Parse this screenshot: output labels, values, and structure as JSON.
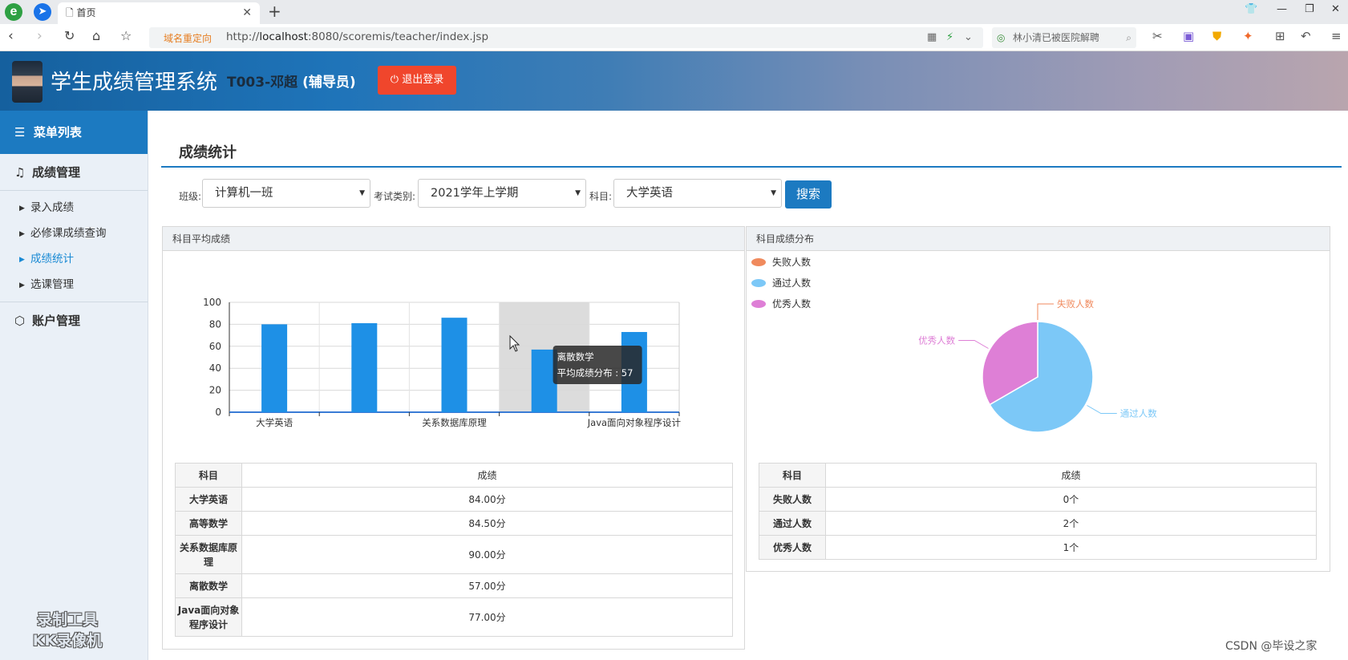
{
  "browser": {
    "tab_title": "首页",
    "logo_glyph": "e",
    "url_prefix": "http://",
    "url_host": "localhost",
    "url_rest": ":8080/scoremis/teacher/index.jsp",
    "redirect_label": "域名重定向",
    "search_text": "林小清已被医院解聘",
    "icons": [
      "back-icon",
      "forward-icon",
      "reload-icon",
      "home-icon",
      "star-icon",
      "qr-icon",
      "bolt-icon",
      "chevron-down-icon",
      "search-icon",
      "scissors-icon",
      "translate-icon",
      "shield-icon",
      "game-icon",
      "grid-icon",
      "undo-icon",
      "menu-icon"
    ]
  },
  "header": {
    "app_title": "学生成绩管理系统",
    "user_id": "T003-邓超",
    "user_role": "(辅导员)",
    "logout_label": "退出登录"
  },
  "sidebar": {
    "menu_title": "菜单列表",
    "groups": [
      {
        "label": "成绩管理",
        "icon": "music-note-icon",
        "items": [
          {
            "label": "录入成绩"
          },
          {
            "label": "必修课成绩查询"
          },
          {
            "label": "成绩统计",
            "active": true
          },
          {
            "label": "选课管理"
          }
        ]
      },
      {
        "label": "账户管理",
        "icon": "cube-icon",
        "items": []
      }
    ],
    "watermark_line1": "录制工具",
    "watermark_line2": "KK录像机"
  },
  "main": {
    "page_title": "成绩统计",
    "filters": {
      "class_label": "班级:",
      "class_value": "计算机一班",
      "exam_label": "考试类别:",
      "exam_value": "2021学年上学期",
      "subject_label": "科目:",
      "subject_value": "大学英语",
      "search_label": "搜索"
    },
    "left_panel": {
      "title": "科目平均成绩",
      "table": {
        "headers": [
          "科目",
          "成绩"
        ],
        "rows": [
          [
            "大学英语",
            "84.00分"
          ],
          [
            "高等数学",
            "84.50分"
          ],
          [
            "关系数据库原理",
            "90.00分"
          ],
          [
            "离散数学",
            "57.00分"
          ],
          [
            "Java面向对象程序设计",
            "77.00分"
          ]
        ]
      }
    },
    "right_panel": {
      "title": "科目成绩分布",
      "table": {
        "headers": [
          "科目",
          "成绩"
        ],
        "rows": [
          [
            "失败人数",
            "0个"
          ],
          [
            "通过人数",
            "2个"
          ],
          [
            "优秀人数",
            "1个"
          ]
        ]
      }
    },
    "footer_credit": "CSDN @毕设之家"
  },
  "chart_data": [
    {
      "type": "bar",
      "categories": [
        "大学英语",
        "高等数学",
        "关系数据库原理",
        "离散数学",
        "Java面向对象程序设计"
      ],
      "tick_labels_shown": [
        "大学英语",
        "关系数据库原理",
        "Java面向对象程序设计"
      ],
      "series": [
        {
          "name": "平均成绩分布",
          "values": [
            80,
            81,
            86,
            57,
            73
          ]
        }
      ],
      "ylim": [
        0,
        100
      ],
      "yticks": [
        0,
        20,
        40,
        60,
        80,
        100
      ],
      "grid": true,
      "color": "#1e90e6",
      "tooltip": {
        "category": "离散数学",
        "line": "平均成绩分布 : 57"
      }
    },
    {
      "type": "pie",
      "legend_position": "top-left",
      "slices": [
        {
          "name": "失败人数",
          "value": 0,
          "color": "#f08a5d"
        },
        {
          "name": "通过人数",
          "value": 2,
          "color": "#7cc8f7"
        },
        {
          "name": "优秀人数",
          "value": 1,
          "color": "#de7fd6"
        }
      ]
    }
  ]
}
